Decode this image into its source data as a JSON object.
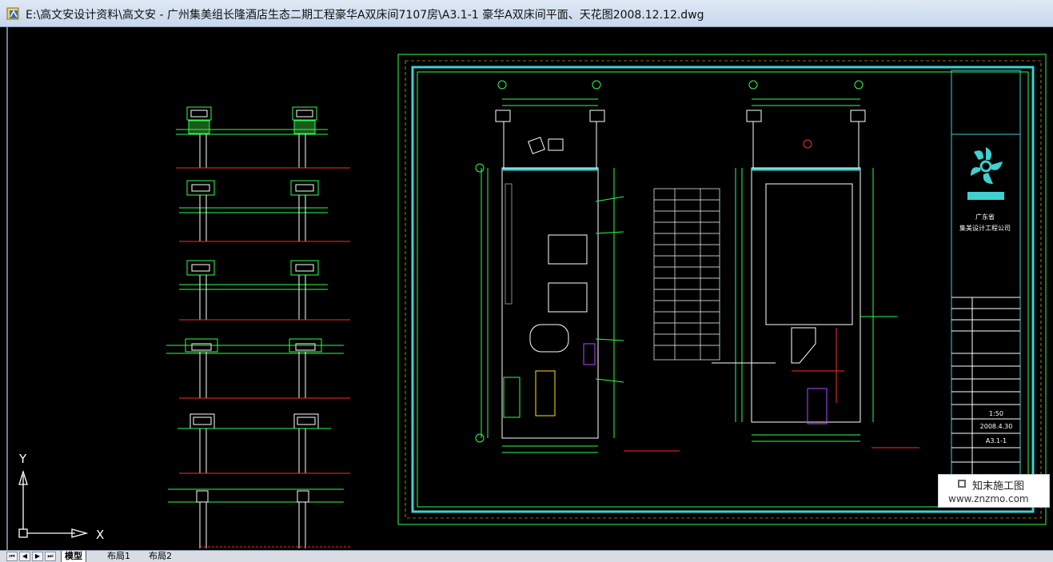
{
  "window": {
    "title": "E:\\高文安设计资料\\高文安 - 广州集美组长隆酒店生态二期工程豪华A双床间7107房\\A3.1-1 豪华A双床间平面、天花图2008.12.12.dwg"
  },
  "ucs": {
    "y_label": "Y",
    "x_label": "X"
  },
  "title_block": {
    "company_line1": "广东省",
    "company_line2": "集美设计工程公司",
    "scale": "1:50",
    "date": "2008.4.30",
    "sheet_no": "A3.1-1"
  },
  "tabs": {
    "model": "模型",
    "layout1": "布局1",
    "layout2": "布局2"
  },
  "watermark": {
    "name": "知末施工图",
    "url": "www.znzmo.com"
  },
  "colors": {
    "drawing_bg": "#000000",
    "cad_green": "#2cff4a",
    "cad_white": "#ffffff",
    "cad_red": "#ff2a2a",
    "cad_cyan": "#3fd0d0",
    "cad_yellow": "#ffe400"
  }
}
